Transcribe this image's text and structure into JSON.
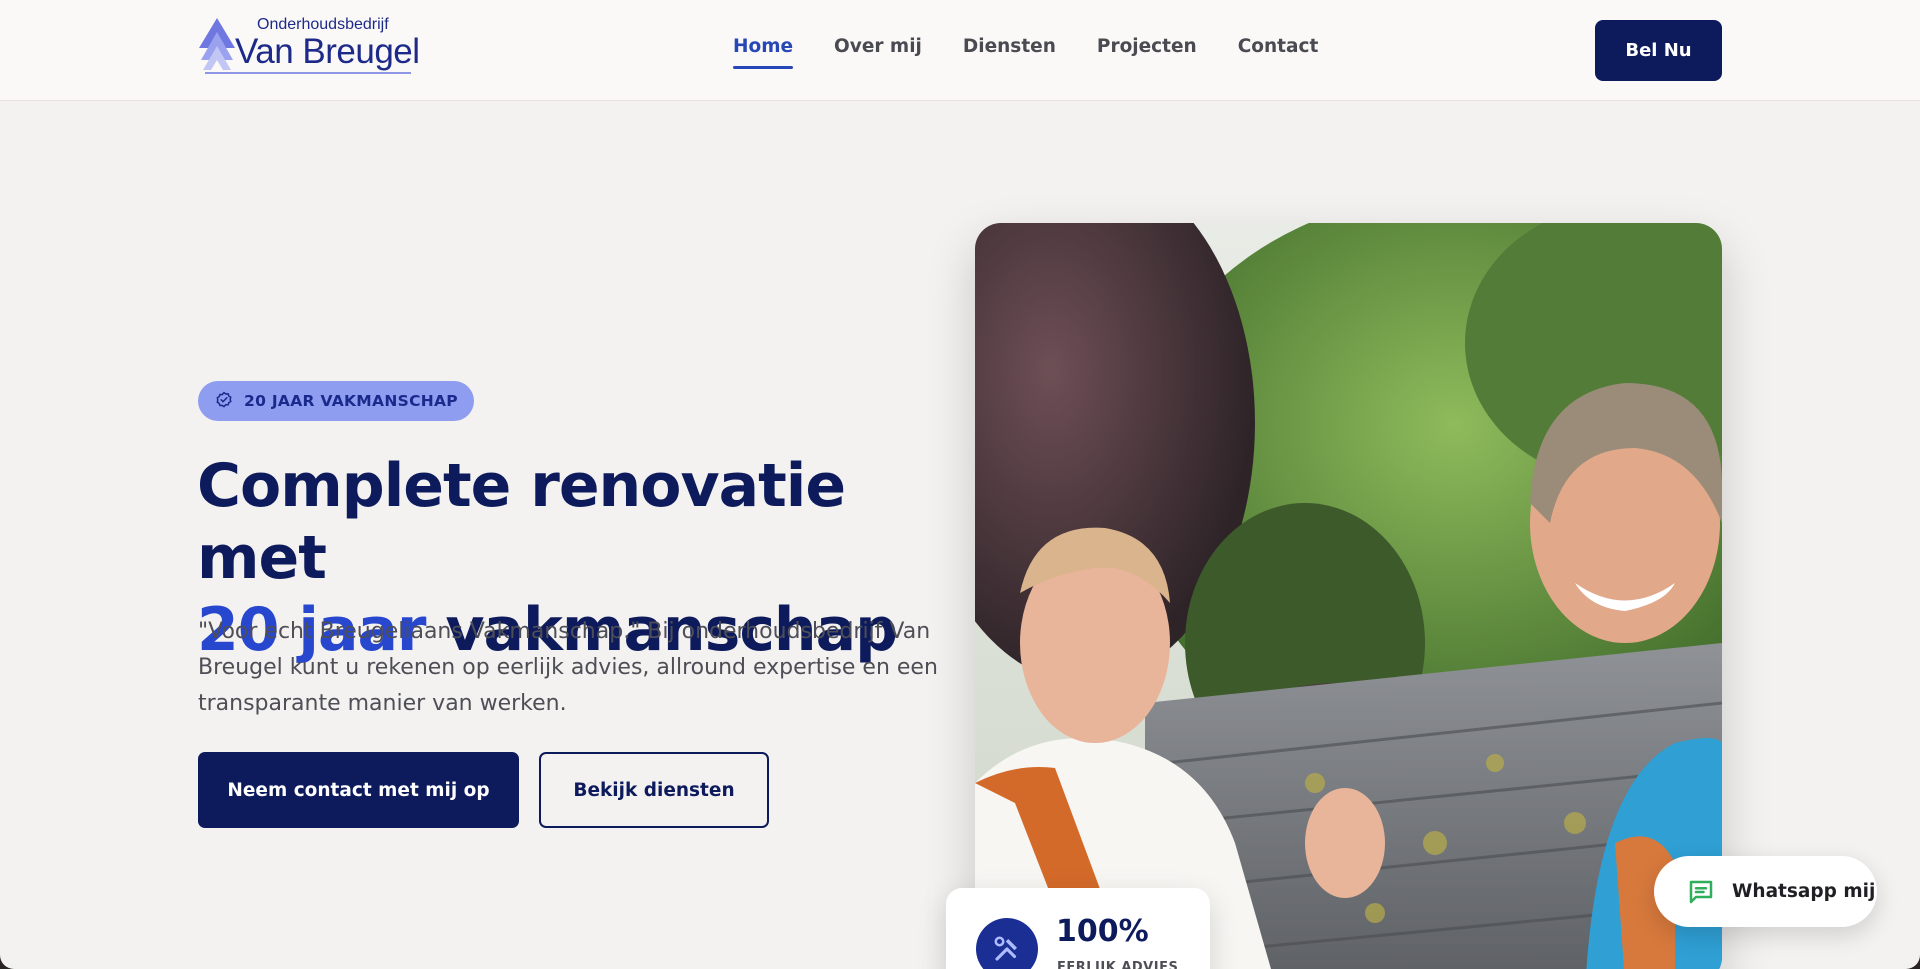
{
  "header": {
    "logo": {
      "line1": "Onderhoudsbedrijf",
      "line2": "Van Breugel"
    },
    "nav": [
      {
        "label": "Home",
        "active": true
      },
      {
        "label": "Over mij",
        "active": false
      },
      {
        "label": "Diensten",
        "active": false
      },
      {
        "label": "Projecten",
        "active": false
      },
      {
        "label": "Contact",
        "active": false
      }
    ],
    "call_label": "Bel Nu"
  },
  "hero": {
    "badge": {
      "icon": "verified-badge-icon",
      "label": "20 JAAR VAKMANSCHAP"
    },
    "title_part1": "Complete renovatie met",
    "title_accent": "20 jaar",
    "title_part2": " vakmanschap",
    "description": "\"Voor echt Breugeliaans Vakmanschap.\" Bij onderhoudsbedrijf Van Breugel kunt u rekenen op eerlijk advies, allround expertise en een transparante manier van werken.",
    "primary_button": "Neem contact met mij op",
    "secondary_button": "Bekijk diensten",
    "stat": {
      "icon": "tools-icon",
      "value": "100%",
      "label": "EERLIJK ADVIES"
    }
  },
  "whatsapp": {
    "icon": "chat-icon",
    "label": "Whatsapp mij"
  },
  "colors": {
    "navy": "#0d1b5c",
    "accent": "#2747cf",
    "badge": "#8f9df0",
    "background": "#f4f2f0"
  }
}
